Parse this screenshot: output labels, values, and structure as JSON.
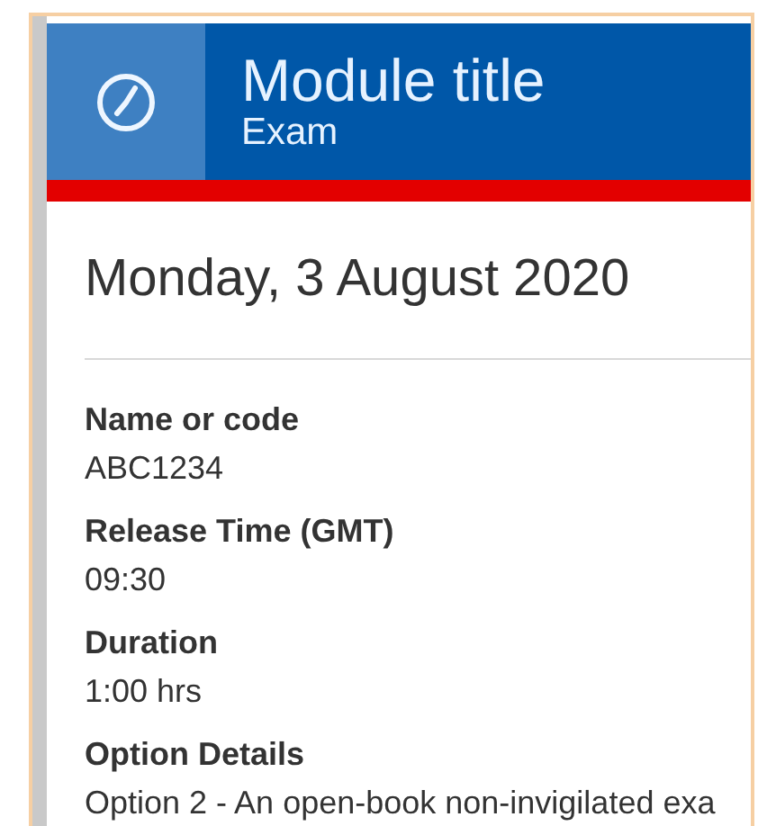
{
  "header": {
    "title": "Module title",
    "subtitle": "Exam"
  },
  "date": "Monday, 3 August 2020",
  "fields": [
    {
      "label": "Name or code",
      "value": "ABC1234"
    },
    {
      "label": "Release Time (GMT)",
      "value": "09:30"
    },
    {
      "label": "Duration",
      "value": "1:00 hrs"
    },
    {
      "label": "Option Details",
      "value": "Option 2 - An open-book non-invigilated exa"
    }
  ]
}
